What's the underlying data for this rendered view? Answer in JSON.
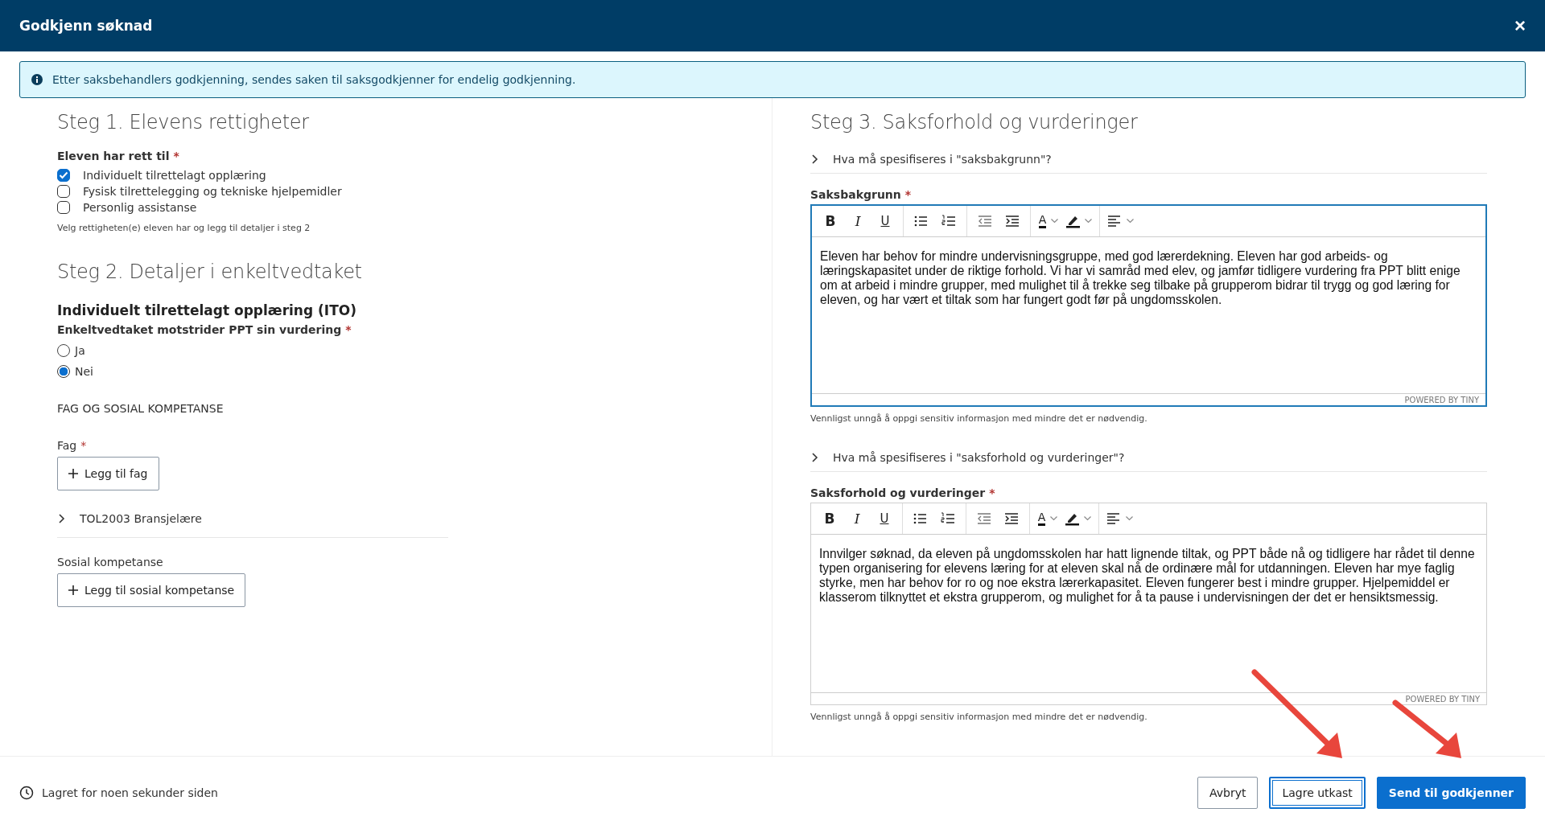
{
  "window": {
    "title": "Godkjenn søknad",
    "close": "×"
  },
  "info_banner": {
    "text": "Etter saksbehandlers godkjenning, sendes saken til saksgodkjenner for endelig godkjenning."
  },
  "step1": {
    "heading": "Steg 1. Elevens rettigheter",
    "label": "Eleven har rett til",
    "required_mark": "*",
    "options": [
      {
        "label": "Individuelt tilrettelagt opplæring",
        "checked": true
      },
      {
        "label": "Fysisk tilrettelegging og tekniske hjelpemidler",
        "checked": false
      },
      {
        "label": "Personlig assistanse",
        "checked": false
      }
    ],
    "hint": "Velg rettigheten(e) eleven har og legg til detaljer i steg 2"
  },
  "step2": {
    "heading": "Steg 2. Detaljer i enkeltvedtaket",
    "subheading": "Individuelt tilrettelagt opplæring (ITO)",
    "question": "Enkeltvedtaket motstrider PPT sin vurdering",
    "required_mark": "*",
    "radios": [
      {
        "label": "Ja",
        "selected": false
      },
      {
        "label": "Nei",
        "selected": true
      }
    ],
    "section_title": "FAG OG SOSIAL KOMPETANSE",
    "fag": {
      "label": "Fag",
      "required_mark": "*",
      "button": "Legg til fag",
      "items": [
        {
          "label": "TOL2003 Bransjelære",
          "expanded": false
        }
      ]
    },
    "sosial": {
      "label": "Sosial kompetanse",
      "button": "Legg til sosial kompetanse"
    }
  },
  "step3": {
    "heading": "Steg 3. Saksforhold og vurderinger",
    "editors": [
      {
        "help": "Hva må spesifiseres i \"saksbakgrunn\"?",
        "help_expanded": false,
        "label": "Saksbakgrunn",
        "required_mark": "*",
        "focused": true,
        "toolbar": [
          {
            "kind": "bold",
            "label": "B"
          },
          {
            "kind": "italic",
            "label": "I"
          },
          {
            "kind": "underline",
            "label": "U"
          },
          {
            "kind": "sep"
          },
          {
            "kind": "bullets"
          },
          {
            "kind": "numbers"
          },
          {
            "kind": "sep"
          },
          {
            "kind": "outdent"
          },
          {
            "kind": "indent"
          },
          {
            "kind": "sep"
          },
          {
            "kind": "fontcolor",
            "label": "A"
          },
          {
            "kind": "highlight"
          },
          {
            "kind": "sep"
          },
          {
            "kind": "align"
          }
        ],
        "text": "Eleven har behov for mindre undervisningsgruppe, med god lærerdekning. Eleven har god arbeids- og læringskapasitet under de riktige forhold. Vi har vi samråd med elev, og jamfør tidligere vurdering fra PPT blitt enige om at arbeid i mindre grupper, med mulighet til å trekke seg tilbake på grupperom bidrar til trygg og god læring for eleven, og har vært et tiltak som har fungert godt før på ungdomsskolen.",
        "branding": "POWERED BY TINY",
        "hint": "Vennligst unngå å oppgi sensitiv informasjon med mindre det er nødvendig."
      },
      {
        "help": "Hva må spesifiseres i \"saksforhold og vurderinger\"?",
        "help_expanded": false,
        "label": "Saksforhold og vurderinger",
        "required_mark": "*",
        "focused": false,
        "toolbar": [
          {
            "kind": "bold",
            "label": "B"
          },
          {
            "kind": "italic",
            "label": "I"
          },
          {
            "kind": "underline",
            "label": "U"
          },
          {
            "kind": "sep"
          },
          {
            "kind": "bullets"
          },
          {
            "kind": "numbers"
          },
          {
            "kind": "sep"
          },
          {
            "kind": "outdent"
          },
          {
            "kind": "indent"
          },
          {
            "kind": "sep"
          },
          {
            "kind": "fontcolor",
            "label": "A"
          },
          {
            "kind": "highlight"
          },
          {
            "kind": "sep"
          },
          {
            "kind": "align"
          }
        ],
        "text": "Innvilger søknad, da eleven på ungdomsskolen har hatt lignende tiltak, og PPT både nå og tidligere har rådet til denne typen organisering for elevens læring for at eleven skal nå de ordinære mål for utdanningen. Eleven har mye faglig styrke, men har behov for ro og noe ekstra lærerkapasitet. Eleven fungerer best i mindre grupper. Hjelpemiddel er klasserom tilknyttet et ekstra grupperom, og mulighet for å ta pause i undervisningen der det er hensiktsmessig.",
        "branding": "POWERED BY TINY",
        "hint": "Vennligst unngå å oppgi sensitiv informasjon med mindre det er nødvendig."
      }
    ]
  },
  "status_bar": {
    "saved": "Lagret for noen sekunder siden",
    "buttons": [
      {
        "label": "Avbryt",
        "kind": "secondary",
        "focused": false
      },
      {
        "label": "Lagre utkast",
        "kind": "secondary",
        "focused": true
      },
      {
        "label": "Send til godkjenner",
        "kind": "primary",
        "focused": false
      }
    ]
  }
}
